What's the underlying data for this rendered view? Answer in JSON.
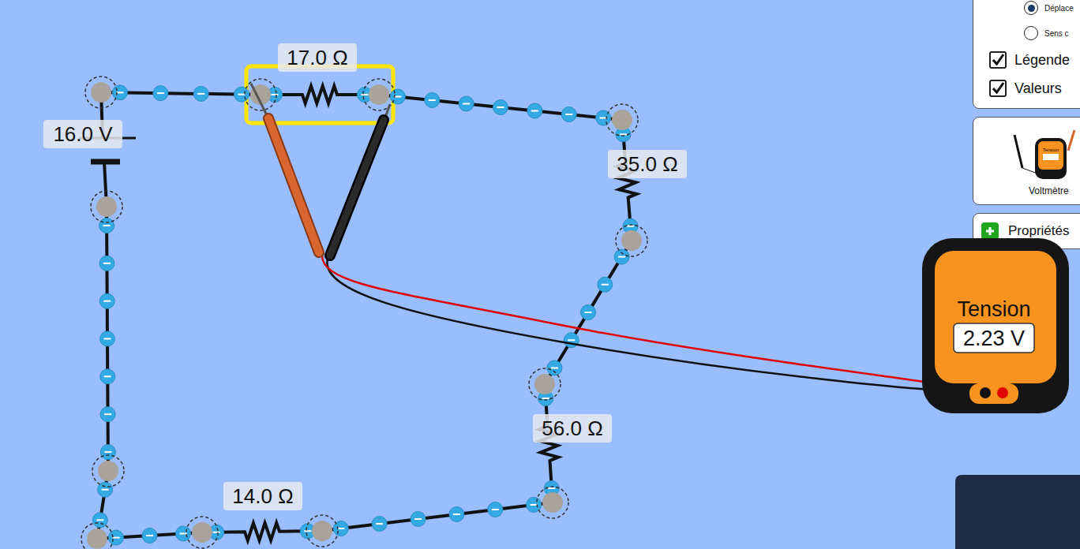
{
  "circuit": {
    "battery": {
      "label": "16.0 V"
    },
    "resistors": [
      {
        "label": "17.0 Ω",
        "selected": true
      },
      {
        "label": "35.0 Ω",
        "selected": false
      },
      {
        "label": "56.0 Ω",
        "selected": false
      },
      {
        "label": "14.0 Ω",
        "selected": false
      }
    ]
  },
  "voltmeter": {
    "title": "Tension",
    "reading": "2.23 V"
  },
  "panel": {
    "radios": [
      {
        "label": "Déplace",
        "selected": true
      },
      {
        "label": "Sens c",
        "selected": false
      }
    ],
    "checkboxes": [
      {
        "label": "Légende",
        "checked": true
      },
      {
        "label": "Valeurs",
        "checked": true
      }
    ],
    "toolbox": {
      "label": "Voltmètre",
      "icon_text": "Tension"
    },
    "properties": {
      "label": "Propriétés",
      "expanded": false
    }
  }
}
